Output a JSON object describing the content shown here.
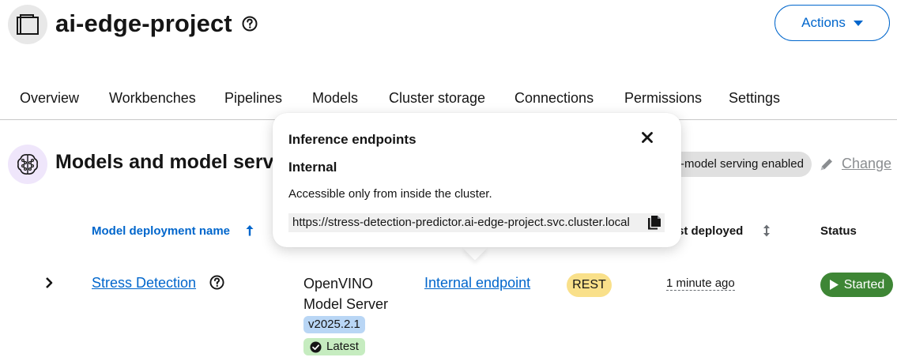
{
  "header": {
    "project_title": "ai-edge-project",
    "project_icon": "folder-icon",
    "help_icon": "help-circle-icon",
    "actions_label": "Actions",
    "accent_color": "#0066cc"
  },
  "tabs": [
    {
      "label": "Overview"
    },
    {
      "label": "Workbenches"
    },
    {
      "label": "Pipelines"
    },
    {
      "label": "Models"
    },
    {
      "label": "Cluster storage"
    },
    {
      "label": "Connections"
    },
    {
      "label": "Permissions"
    },
    {
      "label": "Settings"
    }
  ],
  "section": {
    "title": "Models and model serve",
    "icon": "model-brain-icon",
    "serving_label": "-model serving enabled",
    "change_label": "Change"
  },
  "table": {
    "columns": {
      "name": "Model deployment name",
      "last_deployed": "st deployed",
      "status": "Status"
    },
    "rows": [
      {
        "name": "Stress Detection",
        "serving_runtime": "OpenVINO Model Server",
        "version": "v2025.2.1",
        "latest_label": "Latest",
        "endpoint": "Internal endpoint",
        "api_protocol": "REST",
        "last_deployed": "1 minute ago",
        "status": "Started",
        "status_color": "#3e8635"
      }
    ]
  },
  "popover": {
    "title": "Inference endpoints",
    "subtitle": "Internal",
    "description": "Accessible only from inside the cluster.",
    "url": "https://stress-detection-predictor.ai-edge-project.svc.cluster.local"
  }
}
